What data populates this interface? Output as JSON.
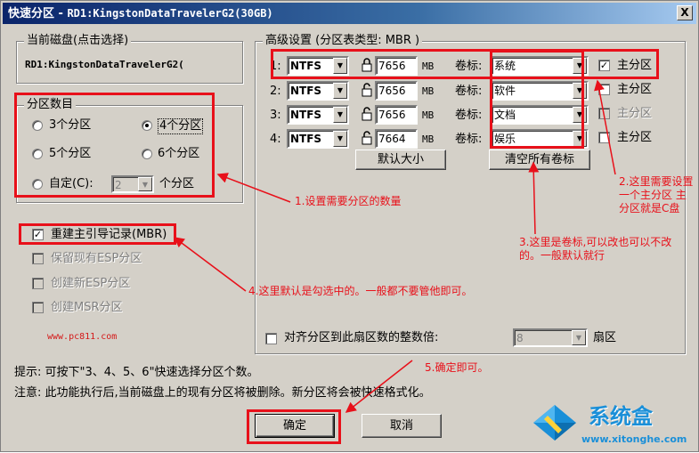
{
  "window": {
    "title_prefix": "快速分区 - ",
    "title_disk": "RD1:KingstonDataTravelerG2(30GB)",
    "close_label": "X"
  },
  "current_disk": {
    "group_title": "当前磁盘(点击选择)",
    "value": "RD1:KingstonDataTravelerG2("
  },
  "partition_count": {
    "group_title": "分区数目",
    "options": [
      "3个分区",
      "4个分区",
      "5个分区",
      "6个分区"
    ],
    "selected": "4个分区",
    "custom_label": "自定(C):",
    "custom_value": "2",
    "custom_suffix": "个分区"
  },
  "options": {
    "rebuild_mbr": "重建主引导记录(MBR)",
    "keep_esp": "保留现有ESP分区",
    "create_esp": "创建新ESP分区",
    "create_msr": "创建MSR分区"
  },
  "watermark_url": "www.pc811.com",
  "advanced": {
    "group_title": "高级设置 (分区表类型: MBR )",
    "label_prefix": "卷标:",
    "unit": "MB",
    "primary_label": "主分区",
    "rows": [
      {
        "index": "1:",
        "fs": "NTFS",
        "size": "7656",
        "label": "系统",
        "primary": true
      },
      {
        "index": "2:",
        "fs": "NTFS",
        "size": "7656",
        "label": "软件",
        "primary": false
      },
      {
        "index": "3:",
        "fs": "NTFS",
        "size": "7656",
        "label": "文档",
        "primary": false
      },
      {
        "index": "4:",
        "fs": "NTFS",
        "size": "7664",
        "label": "娱乐",
        "primary": false
      }
    ],
    "default_size_button": "默认大小",
    "clear_labels_button": "清空所有卷标",
    "align_label": "对齐分区到此扇区数的整数倍:",
    "align_value": "8",
    "align_unit": "扇区"
  },
  "tips": {
    "tip1": "提示: 可按下\"3、4、5、6\"快速选择分区个数。",
    "tip2": "注意: 此功能执行后,当前磁盘上的现有分区将被删除。新分区将会被快速格式化。"
  },
  "buttons": {
    "ok": "确定",
    "cancel": "取消"
  },
  "annotations": {
    "a1": "1.设置需要分区的数量",
    "a2": "2.这里需要设置一个主分区 主分区就是C盘",
    "a3": "3.这里是卷标,可以改也可以不改的。一般默认就行",
    "a4": "4.这里默认是勾选中的。一般都不要管他即可。",
    "a5": "5.确定即可。"
  },
  "brand": {
    "name": "系统盒",
    "url": "www.xitonghe.com"
  },
  "colors": {
    "annotation_red": "#e8101a",
    "title_blue": "#0a246a",
    "brand_blue": "#1a8fd8"
  }
}
